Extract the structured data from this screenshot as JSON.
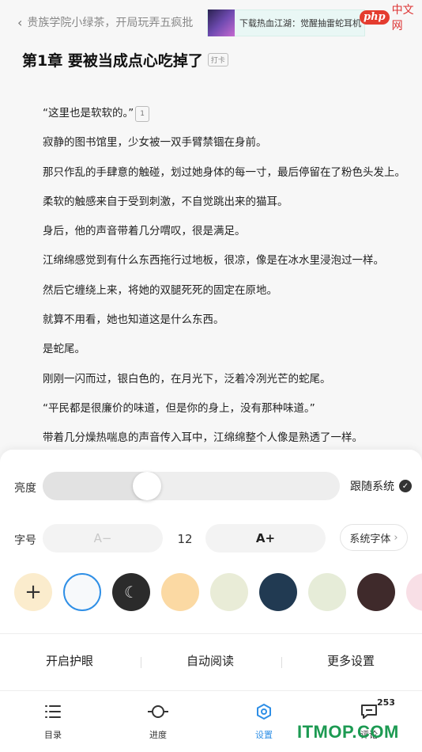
{
  "header": {
    "back_text": "贵族学院小绿茶，开局玩弄五疯批",
    "ad_text": "下载热血江湖：觉醒抽雷蛇耳机",
    "logo_php": "php",
    "logo_cn": "中文网"
  },
  "chapter": {
    "title": "第1章 要被当成点心吃掉了",
    "tag": "打卡"
  },
  "paragraphs": [
    "“这里也是软软的。”",
    "寂静的图书馆里，少女被一双手臂禁锢在身前。",
    "那只作乱的手肆意的触碰，划过她身体的每一寸，最后停留在了粉色头发上。",
    "柔软的触感来自于受到刺激，不自觉跳出来的猫耳。",
    "身后，他的声音带着几分喟叹，很是满足。",
    "江绵绵感觉到有什么东西拖行过地板，很凉，像是在冰水里浸泡过一样。",
    "然后它缠绕上来，将她的双腿死死的固定在原地。",
    "就算不用看，她也知道这是什么东西。",
    "是蛇尾。",
    "刚刚一闪而过，银白色的，在月光下，泛着冷冽光芒的蛇尾。",
    "“平民都是很廉价的味道，但是你的身上，没有那种味道。”",
    "带着几分燥热喘息的声音传入耳中，江绵绵整个人像是熟透了一样。"
  ],
  "first_para_bubble": "1",
  "settings": {
    "brightness_label": "亮度",
    "brightness_value": 0.35,
    "follow_system_label": "跟随系统",
    "font_label": "字号",
    "font_decrease": "A−",
    "font_size": "12",
    "font_increase": "A+",
    "system_font_label": "系统字体",
    "add_label": "+",
    "swatch_colors": [
      "#fbeccd",
      "#f7f9fb",
      "#2b2b2b",
      "#fbd9a3",
      "#e9ecd7",
      "#213a52",
      "#e6ecd8",
      "#3f2a2b",
      "#f8dfe6"
    ],
    "options": [
      "开启护眼",
      "自动阅读",
      "更多设置"
    ]
  },
  "nav": [
    {
      "label": "目录",
      "icon": "list-icon"
    },
    {
      "label": "进度",
      "icon": "progress-icon"
    },
    {
      "label": "设置",
      "icon": "settings-icon"
    },
    {
      "label": "评论",
      "icon": "comment-icon",
      "badge": "253"
    }
  ],
  "watermark": "ITMOP.COM",
  "accent_color": "#2f8fe6"
}
